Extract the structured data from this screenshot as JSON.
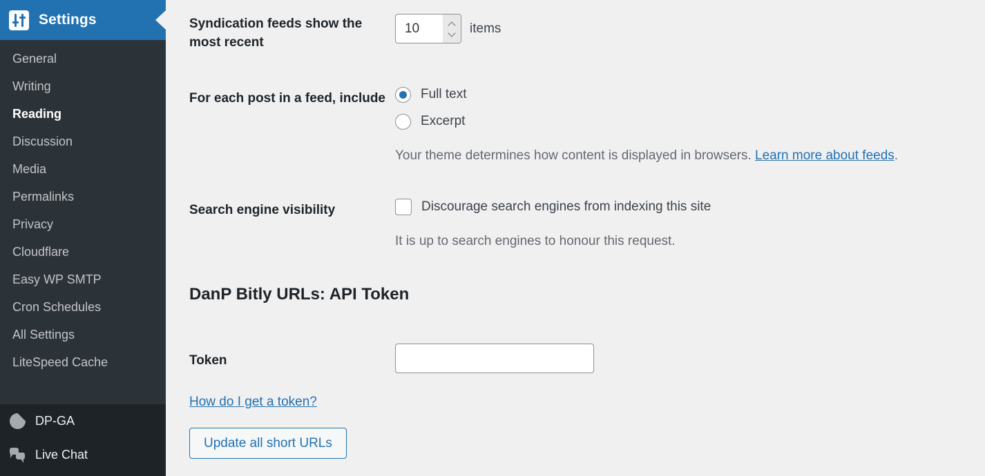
{
  "sidebar": {
    "header": {
      "title": "Settings",
      "icon": "settings-sliders-icon"
    },
    "items": [
      {
        "label": "General",
        "current": false
      },
      {
        "label": "Writing",
        "current": false
      },
      {
        "label": "Reading",
        "current": true
      },
      {
        "label": "Discussion",
        "current": false
      },
      {
        "label": "Media",
        "current": false
      },
      {
        "label": "Permalinks",
        "current": false
      },
      {
        "label": "Privacy",
        "current": false
      },
      {
        "label": "Cloudflare",
        "current": false
      },
      {
        "label": "Easy WP SMTP",
        "current": false
      },
      {
        "label": "Cron Schedules",
        "current": false
      },
      {
        "label": "All Settings",
        "current": false
      },
      {
        "label": "LiteSpeed Cache",
        "current": false
      }
    ],
    "plugins": [
      {
        "label": "DP-GA",
        "icon": "pie-chart-icon"
      },
      {
        "label": "Live Chat",
        "icon": "chat-bubbles-icon"
      }
    ]
  },
  "main": {
    "feeds": {
      "label": "Syndication feeds show the most recent",
      "value": "10",
      "unit": "items"
    },
    "post_include": {
      "label": "For each post in a feed, include",
      "options": [
        {
          "label": "Full text",
          "selected": true
        },
        {
          "label": "Excerpt",
          "selected": false
        }
      ],
      "description_text": "Your theme determines how content is displayed in browsers.",
      "description_link": "Learn more about feeds",
      "description_suffix": "."
    },
    "search_visibility": {
      "label": "Search engine visibility",
      "checkbox_label": "Discourage search engines from indexing this site",
      "checked": false,
      "description": "It is up to search engines to honour this request."
    },
    "bitly": {
      "heading": "DanP Bitly URLs: API Token",
      "token_label": "Token",
      "token_value": "",
      "token_placeholder": "",
      "help_link": "How do I get a token?",
      "update_button": "Update all short URLs"
    }
  },
  "colors": {
    "accent": "#2271b1",
    "sidebar_bg": "#2c3338",
    "sidebar_bg_dark": "#1d2327",
    "page_bg": "#f0f0f1"
  }
}
